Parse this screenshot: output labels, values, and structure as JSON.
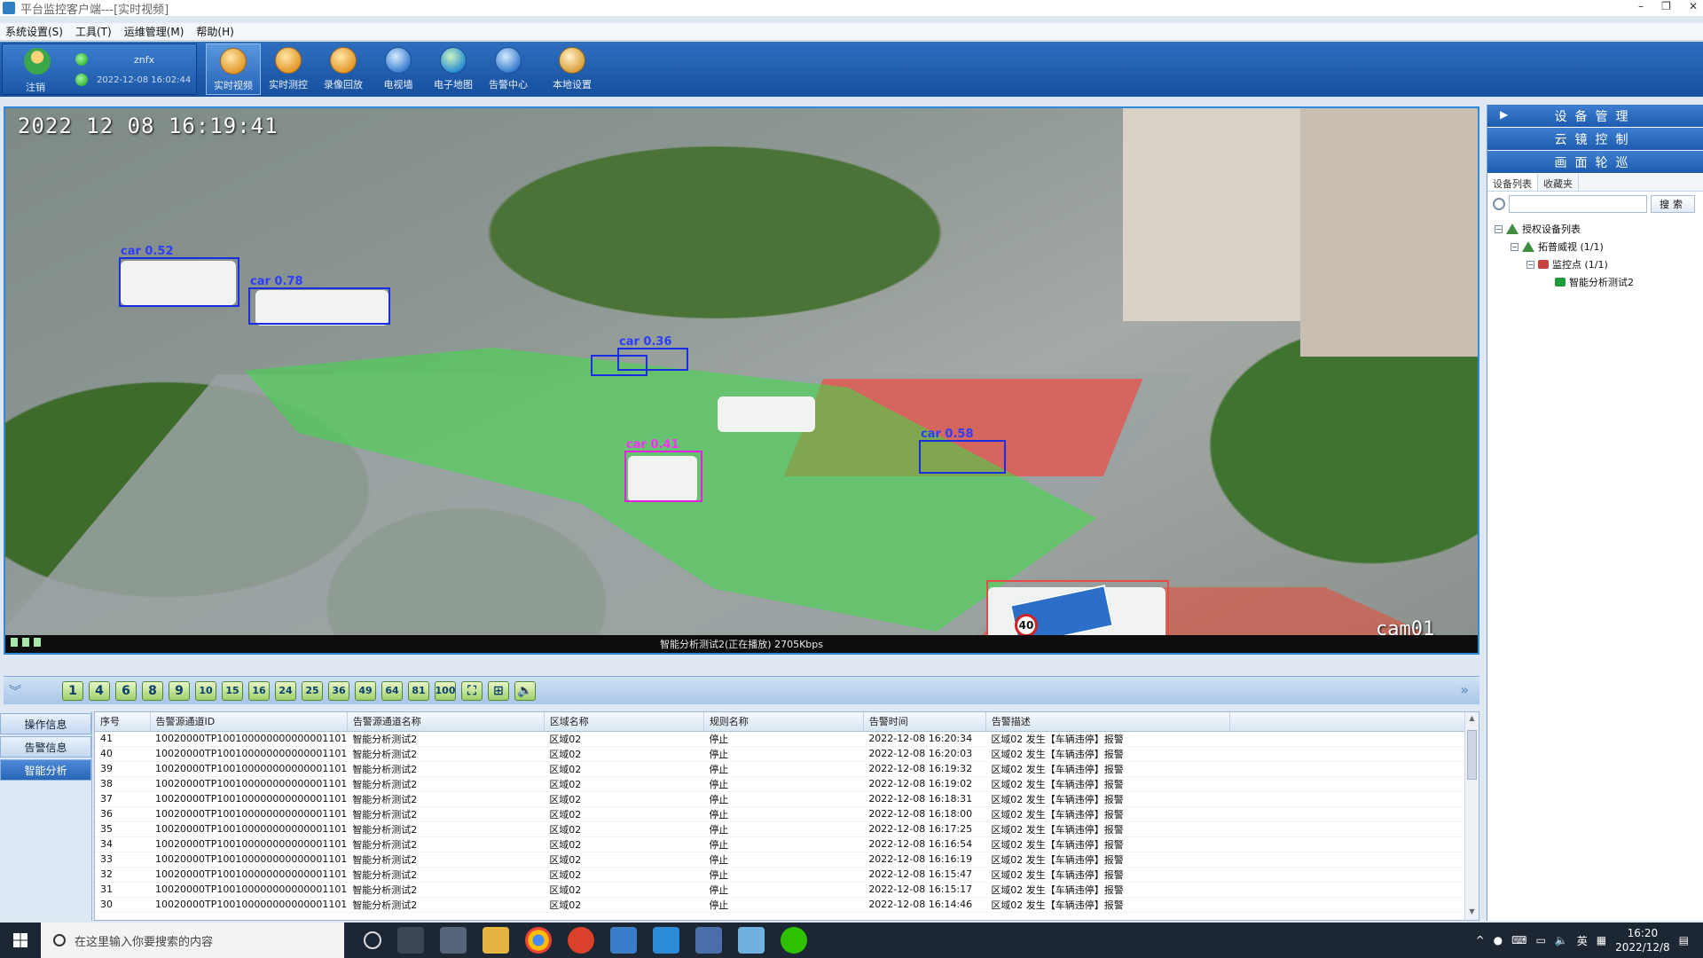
{
  "window": {
    "title": "平台监控客户端---[实时视频]",
    "controls": [
      "–",
      "❐",
      "✕"
    ]
  },
  "menu": [
    "系统设置(S)",
    "工具(T)",
    "运维管理(M)",
    "帮助(H)"
  ],
  "user": {
    "logout_label": "注销",
    "name": "znfx",
    "datetime": "2022-12-08 16:02:44"
  },
  "toolbar": [
    {
      "label": "实时视频",
      "icon": "camera-icon",
      "active": true
    },
    {
      "label": "实时测控",
      "icon": "control-icon"
    },
    {
      "label": "录像回放",
      "icon": "playback-icon"
    },
    {
      "label": "电视墙",
      "icon": "tv-wall-icon"
    },
    {
      "label": "电子地图",
      "icon": "globe-icon"
    },
    {
      "label": "告警中心",
      "icon": "alarm-icon"
    },
    {
      "label": "本地设置",
      "icon": "gear-icon"
    }
  ],
  "video": {
    "timestamp": "2022 12 08 16:19:41",
    "camera": "cam01",
    "status": "智能分析测试2(正在播放) 2705Kbps",
    "detections": [
      {
        "label": "car 0.52",
        "color": "blue"
      },
      {
        "label": "car 0.78",
        "color": "blue"
      },
      {
        "label": "car 0.36",
        "color": "blue"
      },
      {
        "label": "car 0.41",
        "color": "magenta"
      },
      {
        "label": "car 0.58",
        "color": "blue"
      },
      {
        "label": "",
        "color": "red"
      }
    ],
    "sign_number": "40"
  },
  "layout_buttons": [
    "1",
    "4",
    "6",
    "8",
    "9",
    "10",
    "15",
    "16",
    "24",
    "25",
    "36",
    "49",
    "64",
    "81",
    "100"
  ],
  "side_tabs": [
    "操作信息",
    "告警信息",
    "智能分析"
  ],
  "alarm_table": {
    "columns": [
      "序号",
      "告警源通道ID",
      "告警源通道名称",
      "区域名称",
      "规则名称",
      "告警时间",
      "告警描述"
    ],
    "rows": [
      [
        "41",
        "10020000TP100100000000000001101",
        "智能分析测试2",
        "区域02",
        "停止",
        "2022-12-08 16:20:34",
        "区域02  发生【车辆违停】报警"
      ],
      [
        "40",
        "10020000TP100100000000000001101",
        "智能分析测试2",
        "区域02",
        "停止",
        "2022-12-08 16:20:03",
        "区域02  发生【车辆违停】报警"
      ],
      [
        "39",
        "10020000TP100100000000000001101",
        "智能分析测试2",
        "区域02",
        "停止",
        "2022-12-08 16:19:32",
        "区域02  发生【车辆违停】报警"
      ],
      [
        "38",
        "10020000TP100100000000000001101",
        "智能分析测试2",
        "区域02",
        "停止",
        "2022-12-08 16:19:02",
        "区域02  发生【车辆违停】报警"
      ],
      [
        "37",
        "10020000TP100100000000000001101",
        "智能分析测试2",
        "区域02",
        "停止",
        "2022-12-08 16:18:31",
        "区域02  发生【车辆违停】报警"
      ],
      [
        "36",
        "10020000TP100100000000000001101",
        "智能分析测试2",
        "区域02",
        "停止",
        "2022-12-08 16:18:00",
        "区域02  发生【车辆违停】报警"
      ],
      [
        "35",
        "10020000TP100100000000000001101",
        "智能分析测试2",
        "区域02",
        "停止",
        "2022-12-08 16:17:25",
        "区域02  发生【车辆违停】报警"
      ],
      [
        "34",
        "10020000TP100100000000000001101",
        "智能分析测试2",
        "区域02",
        "停止",
        "2022-12-08 16:16:54",
        "区域02  发生【车辆违停】报警"
      ],
      [
        "33",
        "10020000TP100100000000000001101",
        "智能分析测试2",
        "区域02",
        "停止",
        "2022-12-08 16:16:19",
        "区域02  发生【车辆违停】报警"
      ],
      [
        "32",
        "10020000TP100100000000000001101",
        "智能分析测试2",
        "区域02",
        "停止",
        "2022-12-08 16:15:47",
        "区域02  发生【车辆违停】报警"
      ],
      [
        "31",
        "10020000TP100100000000000001101",
        "智能分析测试2",
        "区域02",
        "停止",
        "2022-12-08 16:15:17",
        "区域02  发生【车辆违停】报警"
      ],
      [
        "30",
        "10020000TP100100000000000001101",
        "智能分析测试2",
        "区域02",
        "停止",
        "2022-12-08 16:14:46",
        "区域02  发生【车辆违停】报警"
      ]
    ]
  },
  "right_panel": {
    "headers": [
      "设备管理",
      "云镜控制",
      "画面轮巡"
    ],
    "tabs": [
      "设备列表",
      "收藏夹"
    ],
    "search_placeholder": "",
    "search_button": "搜索",
    "tree": [
      {
        "label": "授权设备列表",
        "level": 0
      },
      {
        "label": "拓普威视 (1/1)",
        "level": 1
      },
      {
        "label": "监控点 (1/1)",
        "level": 2
      },
      {
        "label": "智能分析测试2",
        "level": 3
      }
    ]
  },
  "taskbar": {
    "search_placeholder": "在这里输入你要搜索的内容",
    "tray_lang": "英",
    "time": "16:20",
    "date": "2022/12/8"
  }
}
